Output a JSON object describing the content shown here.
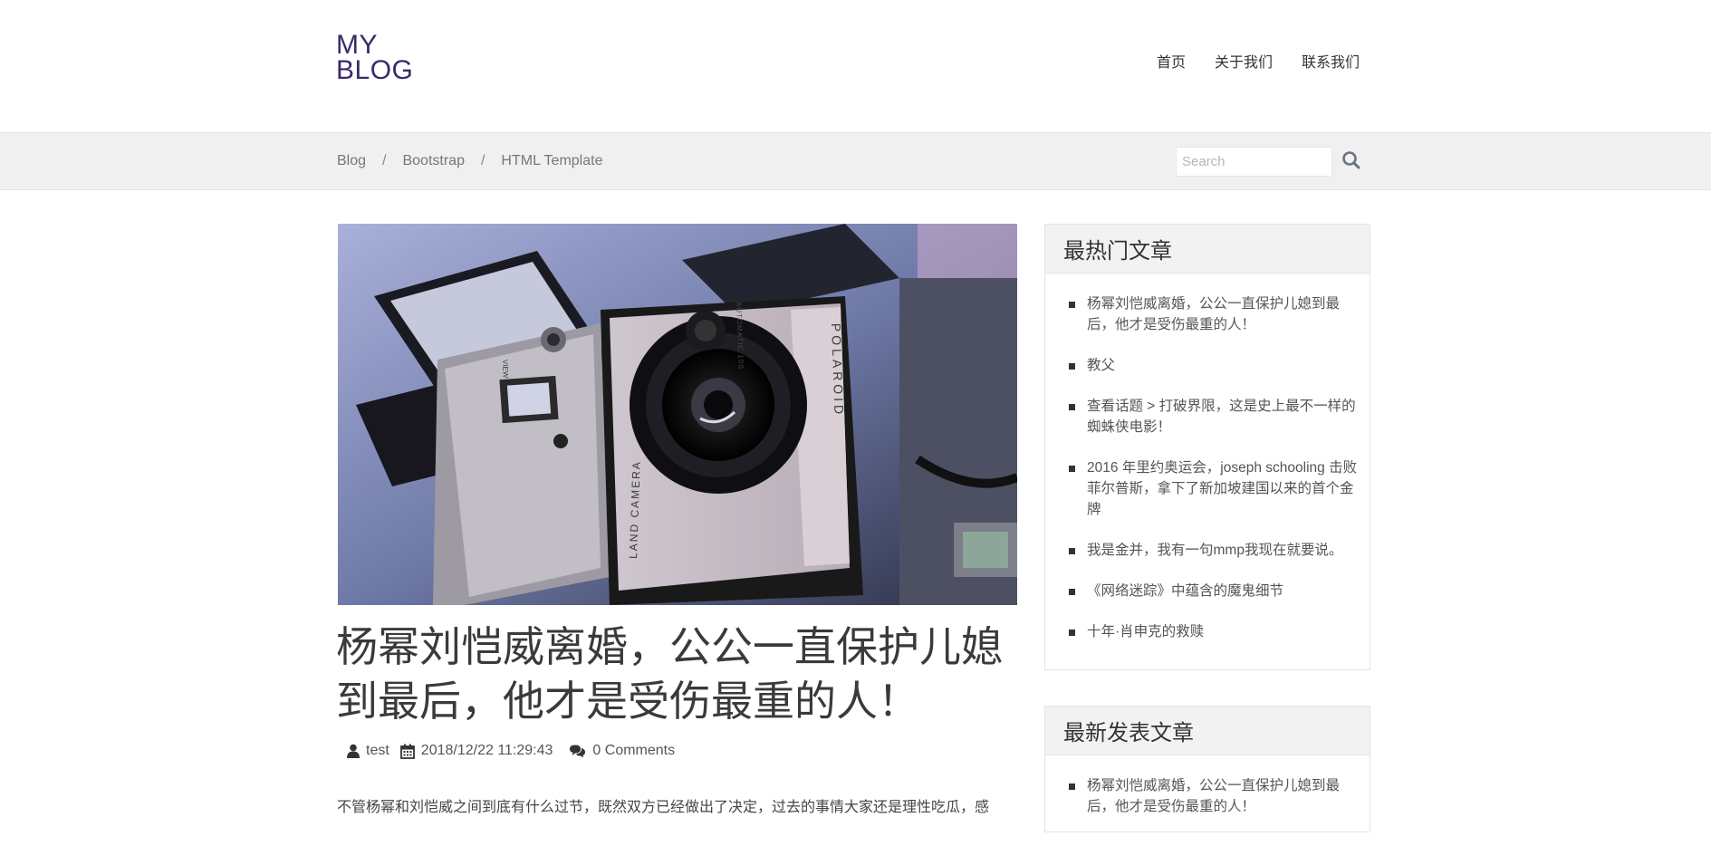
{
  "site": {
    "logo_line1": "MY",
    "logo_line2": "BLOG"
  },
  "nav": [
    {
      "label": "首页"
    },
    {
      "label": "关于我们"
    },
    {
      "label": "联系我们"
    }
  ],
  "breadcrumb": [
    "Blog",
    "Bootstrap",
    "HTML Template"
  ],
  "breadcrumb_separator": "/",
  "search": {
    "placeholder": "Search"
  },
  "post": {
    "title": "杨幂刘恺威离婚，公公一直保护儿媳到最后，他才是受伤最重的人！",
    "author": "test",
    "date": "2018/12/22 11:29:43",
    "comments": "0 Comments",
    "excerpt": "不管杨幂和刘恺威之间到底有什么过节，既然双方已经做出了决定，过去的事情大家还是理性吃瓜，感",
    "image_camera_text": {
      "brand": "POLAROID",
      "model": "LAND CAMERA",
      "auto": "AUTOMATIC 100",
      "view": "VIEW"
    }
  },
  "sidebar": {
    "hot": {
      "title": "最热门文章",
      "items": [
        "杨幂刘恺威离婚，公公一直保护儿媳到最后，他才是受伤最重的人！",
        "教父",
        "查看话题 > 打破界限，这是史上最不一样的蜘蛛侠电影！",
        "2016 年里约奥运会，joseph schooling 击败菲尔普斯，拿下了新加坡建国以来的首个金牌",
        "我是金并，我有一句mmp我现在就要说。",
        "《网络迷踪》中蕴含的魔鬼细节",
        "十年·肖申克的救赎"
      ]
    },
    "latest": {
      "title": "最新发表文章",
      "items": [
        "杨幂刘恺威离婚，公公一直保护儿媳到最后，他才是受伤最重的人！"
      ]
    }
  },
  "colors": {
    "logo": "#3a2a6b",
    "crumb_bar": "#f0f0f0",
    "text": "#333333"
  }
}
